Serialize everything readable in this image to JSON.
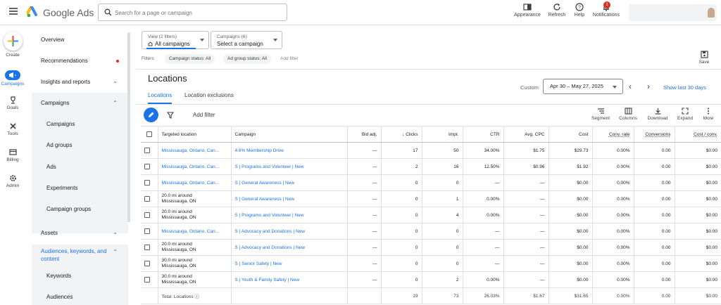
{
  "app": {
    "name": "Google Ads",
    "search_placeholder": "Search for a page or campaign"
  },
  "topbar": {
    "actions": [
      {
        "label": "Appearance",
        "icon": "appearance-icon"
      },
      {
        "label": "Refresh",
        "icon": "refresh-icon"
      },
      {
        "label": "Help",
        "icon": "help-icon"
      },
      {
        "label": "Notifications",
        "icon": "bell-icon"
      }
    ],
    "notification_count": "1"
  },
  "rail": [
    {
      "label": "Create",
      "icon": "plus-icon"
    },
    {
      "label": "Campaigns",
      "icon": "megaphone-icon"
    },
    {
      "label": "Goals",
      "icon": "trophy-icon"
    },
    {
      "label": "Tools",
      "icon": "tools-icon"
    },
    {
      "label": "Billing",
      "icon": "card-icon"
    },
    {
      "label": "Admin",
      "icon": "gear-icon"
    }
  ],
  "nav": {
    "overview": "Overview",
    "recommendations": "Recommendations",
    "insights": "Insights and reports",
    "campaigns_group": "Campaigns",
    "campaigns_items": [
      "Campaigns",
      "Ad groups",
      "Ads",
      "Experiments",
      "Campaign groups"
    ],
    "assets": "Assets",
    "audiences_group": "Audiences, keywords, and content",
    "audiences_items": [
      "Keywords",
      "Audiences"
    ]
  },
  "filters": {
    "view_label": "View (2 filters)",
    "view_value": "All campaigns",
    "campaigns_label": "Campaigns (6)",
    "campaigns_value": "Select a campaign",
    "filters_label": "Filters",
    "chips": [
      "Campaign status: All",
      "Ad group status: All"
    ],
    "add_filter": "Add filter"
  },
  "save_label": "Save",
  "page": {
    "title": "Locations",
    "tabs": [
      "Locations",
      "Location exclusions"
    ],
    "custom_label": "Custom",
    "date_range": "Apr 30 – May 27, 2025",
    "show_last": "Show last 30 days"
  },
  "toolbar": {
    "add_filter": "Add filter",
    "tools": [
      {
        "label": "Segment",
        "icon": "segment-icon"
      },
      {
        "label": "Columns",
        "icon": "columns-icon"
      },
      {
        "label": "Download",
        "icon": "download-icon"
      },
      {
        "label": "Expand",
        "icon": "expand-icon"
      },
      {
        "label": "More",
        "icon": "more-vert-icon"
      }
    ]
  },
  "table": {
    "headers": [
      "Targeted location",
      "Campaign",
      "Bid adj.",
      "Clicks",
      "Impr.",
      "CTR",
      "Avg. CPC",
      "Cost",
      "Conv. rate",
      "Conversions",
      "Cost / conv."
    ],
    "rows": [
      {
        "loc1": "Mississauga, Ontario, Can...",
        "loc2": "",
        "campaign": "4.6% Membership Drive",
        "bid": "—",
        "clicks": "17",
        "impr": "50",
        "ctr": "34.00%",
        "cpc": "$1.75",
        "cost": "$29.73",
        "convrate": "0.00%",
        "conv": "0.00",
        "costconv": "$0.00"
      },
      {
        "loc1": "Mississauga, Ontario, Can...",
        "loc2": "",
        "campaign": "S | Programs and Volunteer | New",
        "bid": "—",
        "clicks": "2",
        "impr": "16",
        "ctr": "12.50%",
        "cpc": "$0.96",
        "cost": "$1.92",
        "convrate": "0.00%",
        "conv": "0.00",
        "costconv": "$0.00"
      },
      {
        "loc1": "Mississauga, Ontario, Can...",
        "loc2": "",
        "campaign": "S | General Awareness | New",
        "bid": "—",
        "clicks": "0",
        "impr": "0",
        "ctr": "—",
        "cpc": "—",
        "cost": "$0.00",
        "convrate": "0.00%",
        "conv": "0.00",
        "costconv": "$0.00"
      },
      {
        "loc1": "20.0 mi around",
        "loc2": "Mississauga, ON",
        "campaign": "S | General Awareness | New",
        "bid": "—",
        "clicks": "0",
        "impr": "1",
        "ctr": "0.00%",
        "cpc": "—",
        "cost": "$0.00",
        "convrate": "0.00%",
        "conv": "0.00",
        "costconv": "$0.00"
      },
      {
        "loc1": "20.0 mi around",
        "loc2": "Mississauga, ON",
        "campaign": "S | Programs and Volunteer | New",
        "bid": "—",
        "clicks": "0",
        "impr": "4",
        "ctr": "0.00%",
        "cpc": "—",
        "cost": "$0.00",
        "convrate": "0.00%",
        "conv": "0.00",
        "costconv": "$0.00"
      },
      {
        "loc1": "Mississauga, Ontario, Can...",
        "loc2": "",
        "campaign": "S | Advocacy and Donations | New",
        "bid": "—",
        "clicks": "0",
        "impr": "0",
        "ctr": "—",
        "cpc": "—",
        "cost": "$0.00",
        "convrate": "0.00%",
        "conv": "0.00",
        "costconv": "$0.00"
      },
      {
        "loc1": "20.0 mi around",
        "loc2": "Mississauga, ON",
        "campaign": "S | Advocacy and Donations | New",
        "bid": "—",
        "clicks": "0",
        "impr": "0",
        "ctr": "—",
        "cpc": "—",
        "cost": "$0.00",
        "convrate": "0.00%",
        "conv": "0.00",
        "costconv": "$0.00"
      },
      {
        "loc1": "30.0 mi around",
        "loc2": "Mississauga, ON",
        "campaign": "S | Senior Safety | New",
        "bid": "—",
        "clicks": "0",
        "impr": "0",
        "ctr": "—",
        "cpc": "—",
        "cost": "$0.00",
        "convrate": "0.00%",
        "conv": "0.00",
        "costconv": "$0.00"
      },
      {
        "loc1": "30.0 mi around",
        "loc2": "Mississauga, ON",
        "campaign": "S | Youth & Family Safety | New",
        "bid": "—",
        "clicks": "0",
        "impr": "2",
        "ctr": "0.00%",
        "cpc": "—",
        "cost": "$0.00",
        "convrate": "0.00%",
        "conv": "0.00",
        "costconv": "$0.00"
      }
    ],
    "total": {
      "label": "Total: Locations",
      "clicks": "19",
      "impr": "73",
      "ctr": "26.03%",
      "cpc": "$1.67",
      "cost": "$31.65",
      "convrate": "0.00%",
      "conv": "0.00",
      "costconv": "$0.00"
    }
  }
}
